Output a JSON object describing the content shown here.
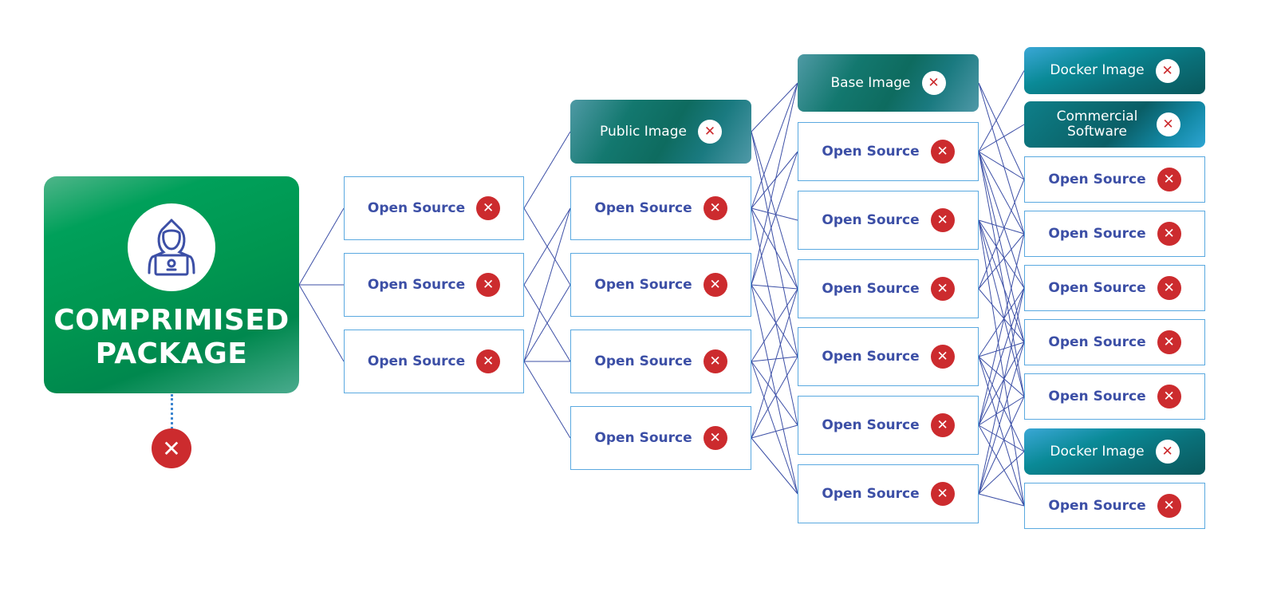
{
  "colors": {
    "edge": "#3c4fa6",
    "fail": "#cc2b2e",
    "border": "#5aa9e0",
    "main": "#00a05a"
  },
  "root": {
    "title_line1": "COMPRIMISED",
    "title_line2": "PACKAGE",
    "icon": "hacker-icon",
    "status_icon": "x-icon"
  },
  "columns": [
    [
      {
        "label": "Open Source",
        "type": "os"
      },
      {
        "label": "Open Source",
        "type": "os"
      },
      {
        "label": "Open Source",
        "type": "os"
      }
    ],
    [
      {
        "label": "Public Image",
        "type": "public"
      },
      {
        "label": "Open Source",
        "type": "os"
      },
      {
        "label": "Open Source",
        "type": "os"
      },
      {
        "label": "Open Source",
        "type": "os"
      },
      {
        "label": "Open Source",
        "type": "os"
      }
    ],
    [
      {
        "label": "Base Image",
        "type": "base"
      },
      {
        "label": "Open Source",
        "type": "os"
      },
      {
        "label": "Open Source",
        "type": "os"
      },
      {
        "label": "Open Source",
        "type": "os"
      },
      {
        "label": "Open Source",
        "type": "os"
      },
      {
        "label": "Open Source",
        "type": "os"
      },
      {
        "label": "Open Source",
        "type": "os"
      }
    ],
    [
      {
        "label": "Docker Image",
        "type": "docker"
      },
      {
        "label": "Commercial Software",
        "type": "commercial"
      },
      {
        "label": "Open Source",
        "type": "os"
      },
      {
        "label": "Open Source",
        "type": "os"
      },
      {
        "label": "Open Source",
        "type": "os"
      },
      {
        "label": "Open Source",
        "type": "os"
      },
      {
        "label": "Open Source",
        "type": "os"
      },
      {
        "label": "Docker Image",
        "type": "docker"
      },
      {
        "label": "Open Source",
        "type": "os"
      }
    ]
  ],
  "edges": [
    [
      [
        0,
        0
      ],
      [
        0,
        1
      ],
      [
        0,
        2
      ]
    ],
    [
      [
        0,
        0
      ],
      [
        0,
        2
      ],
      [
        1,
        1
      ],
      [
        1,
        3
      ],
      [
        2,
        1
      ],
      [
        2,
        2
      ],
      [
        2,
        3
      ],
      [
        2,
        4
      ]
    ],
    [
      [
        0,
        0
      ],
      [
        0,
        3
      ],
      [
        0,
        4
      ],
      [
        1,
        0
      ],
      [
        1,
        1
      ],
      [
        1,
        2
      ],
      [
        1,
        3
      ],
      [
        1,
        5
      ],
      [
        2,
        0
      ],
      [
        2,
        1
      ],
      [
        2,
        3
      ],
      [
        2,
        4
      ],
      [
        2,
        6
      ],
      [
        3,
        3
      ],
      [
        3,
        4
      ],
      [
        3,
        5
      ],
      [
        3,
        6
      ],
      [
        4,
        3
      ],
      [
        4,
        4
      ],
      [
        4,
        5
      ],
      [
        4,
        6
      ]
    ],
    [
      [
        0,
        2
      ],
      [
        0,
        3
      ],
      [
        1,
        0
      ],
      [
        1,
        1
      ],
      [
        1,
        2
      ],
      [
        1,
        3
      ],
      [
        1,
        4
      ],
      [
        1,
        5
      ],
      [
        1,
        6
      ],
      [
        2,
        3
      ],
      [
        2,
        4
      ],
      [
        2,
        5
      ],
      [
        2,
        6
      ],
      [
        2,
        8
      ],
      [
        3,
        2
      ],
      [
        3,
        3
      ],
      [
        3,
        5
      ],
      [
        4,
        4
      ],
      [
        4,
        5
      ],
      [
        4,
        6
      ],
      [
        4,
        7
      ],
      [
        4,
        8
      ],
      [
        5,
        3
      ],
      [
        5,
        4
      ],
      [
        5,
        5
      ],
      [
        5,
        6
      ],
      [
        5,
        7
      ],
      [
        5,
        8
      ],
      [
        6,
        4
      ],
      [
        6,
        5
      ],
      [
        6,
        6
      ],
      [
        6,
        7
      ],
      [
        6,
        8
      ]
    ]
  ]
}
